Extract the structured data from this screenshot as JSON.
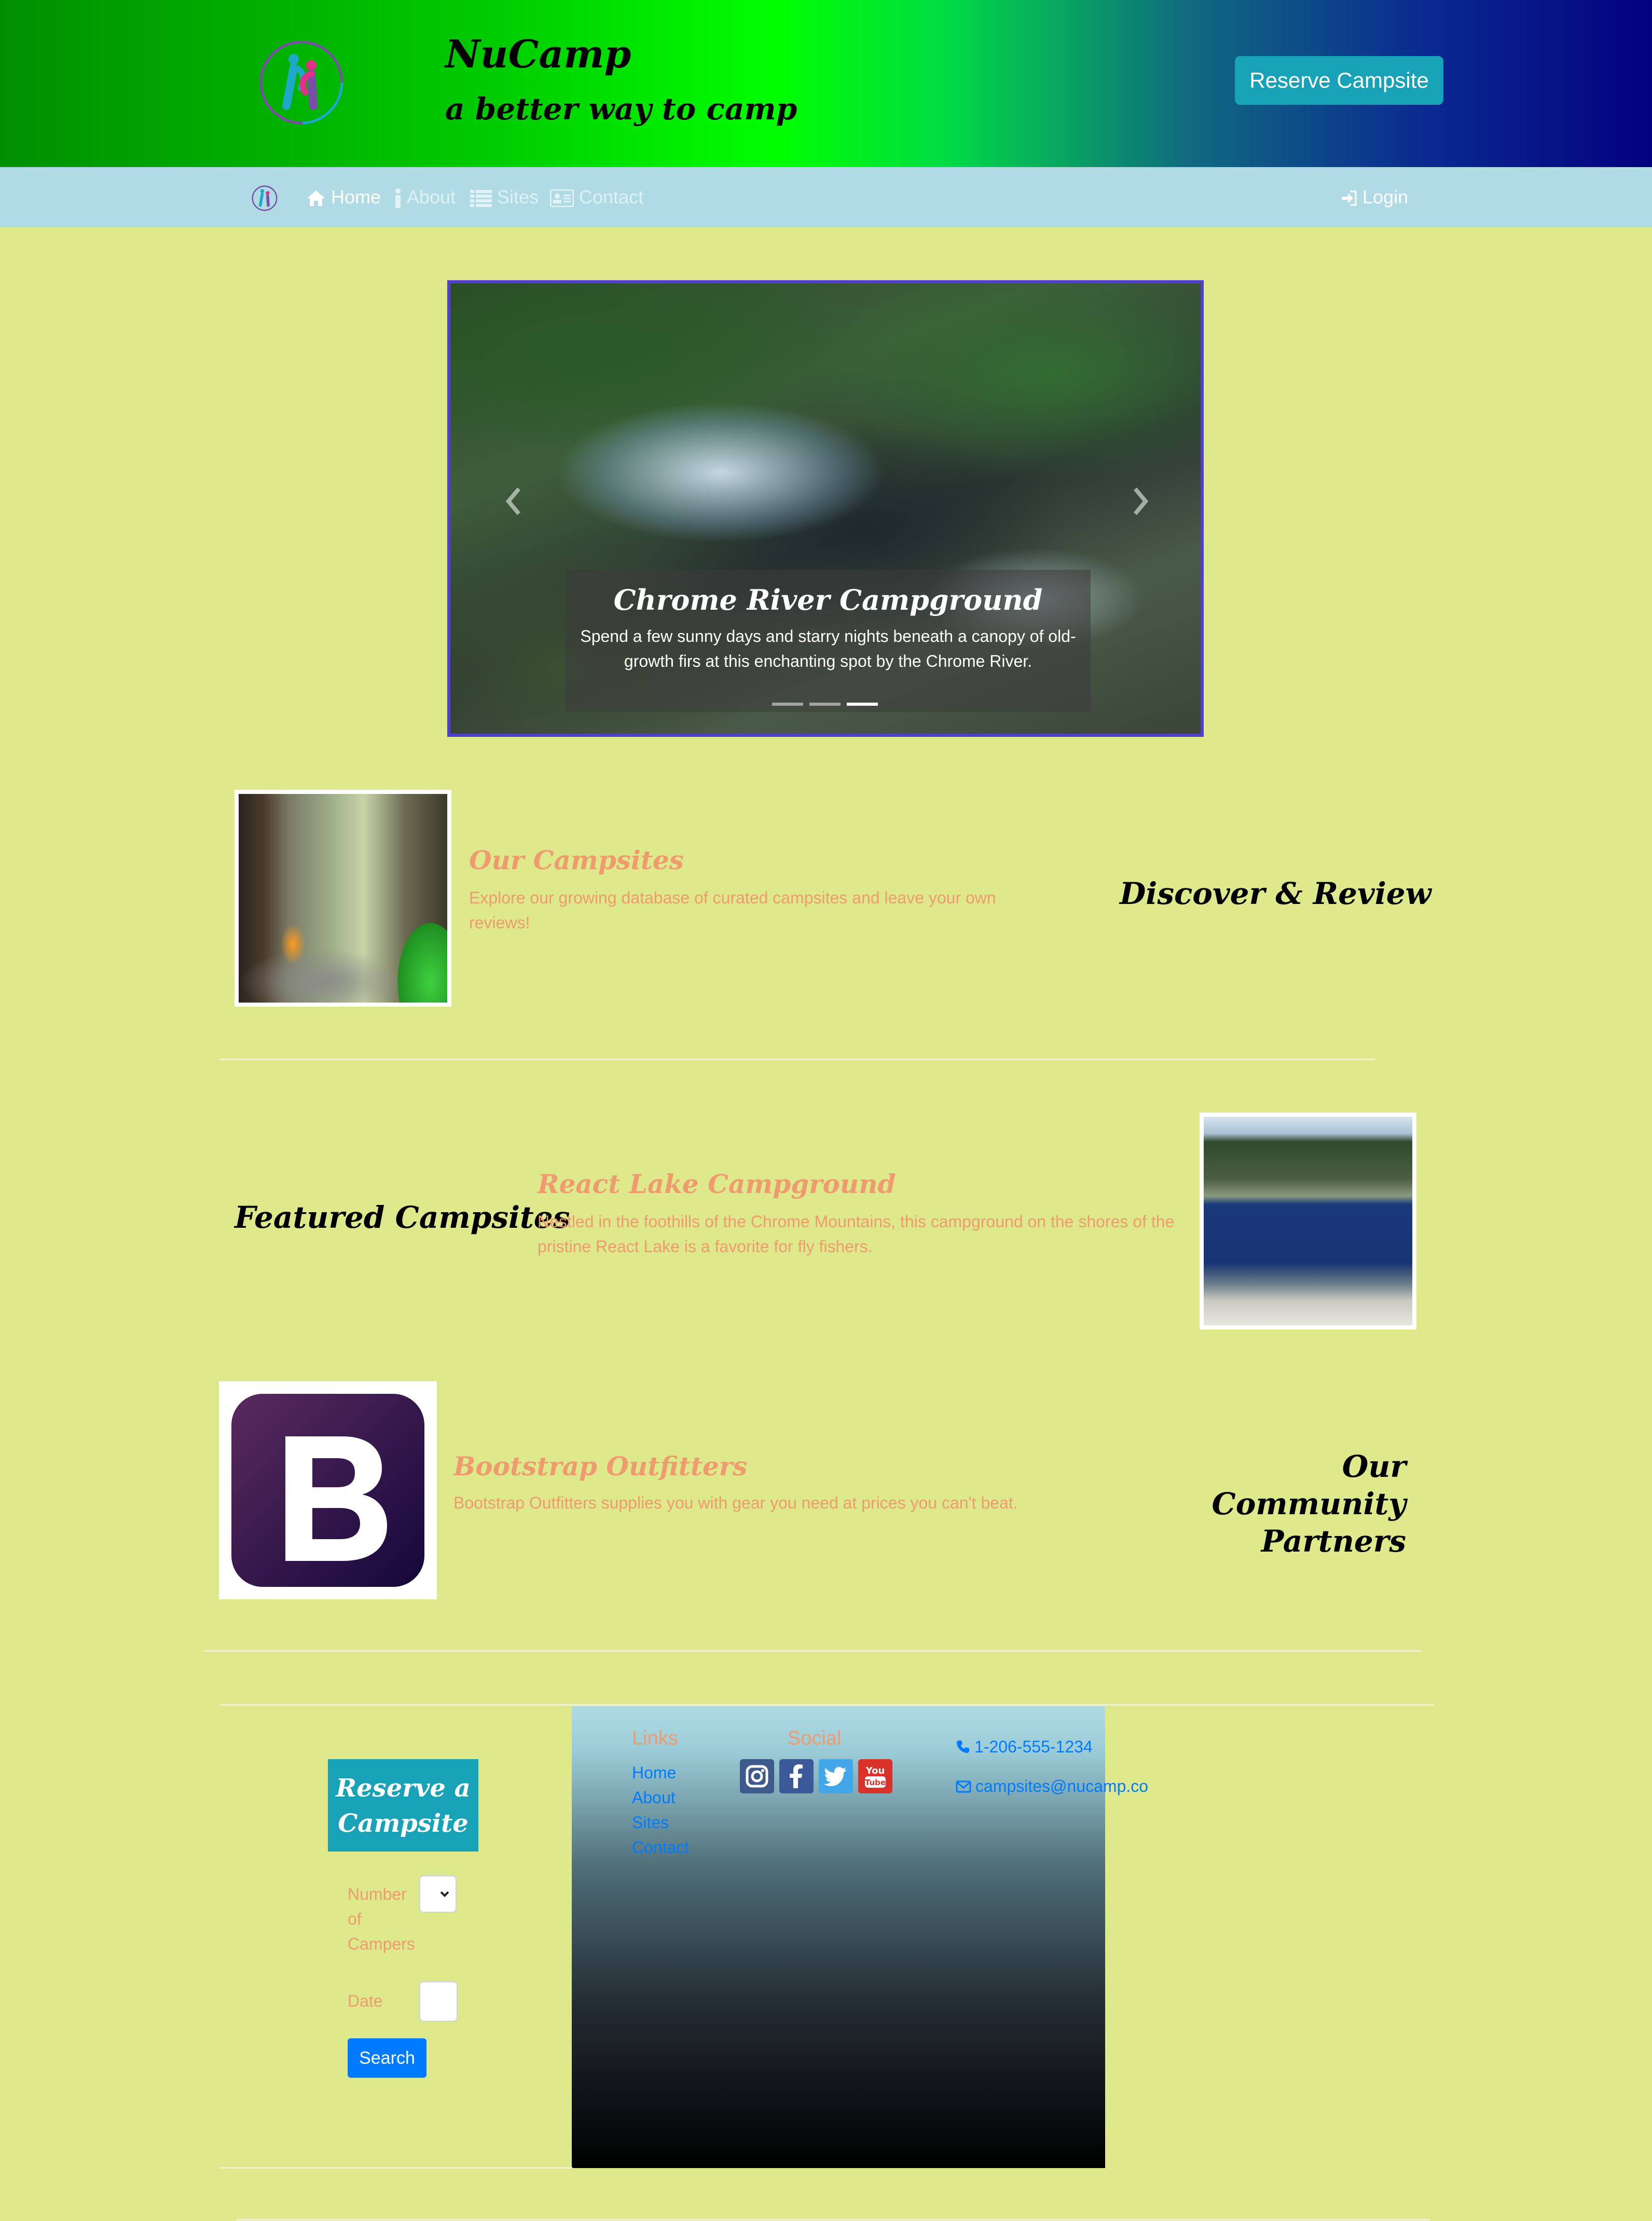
{
  "header": {
    "title": "NuCamp",
    "subtitle": "a better way to camp",
    "reserve_button": "Reserve Campsite",
    "logo_icon": "nucamp-logo-icon"
  },
  "nav": {
    "items": [
      {
        "label": "Home",
        "icon": "home-icon",
        "active": true
      },
      {
        "label": "About",
        "icon": "info-icon",
        "active": false
      },
      {
        "label": "Sites",
        "icon": "list-icon",
        "active": false
      },
      {
        "label": "Contact",
        "icon": "address-card-icon",
        "active": false
      }
    ],
    "login": "Login"
  },
  "carousel": {
    "title": "Chrome River Campground",
    "text": "Spend a few sunny days and starry nights beneath a canopy of old-growth firs at this enchanting spot by the Chrome River.",
    "indicator_count": 3,
    "active_indicator": 3
  },
  "sections": {
    "campsites": {
      "heading": "Our Campsites",
      "text": "Explore our growing database of curated campsites and leave your own reviews!",
      "side_heading": "Discover & Review"
    },
    "featured": {
      "side_heading": "Featured Campsites",
      "heading": "React Lake Campground",
      "text": "Nestled in the foothills of the Chrome Mountains, this campground on the shores of the pristine React Lake is a favorite for fly fishers."
    },
    "partners": {
      "heading": "Bootstrap Outfitters",
      "text": "Bootstrap Outfitters supplies you with gear you need at prices you can't beat.",
      "side_heading_line1": "Our Community",
      "side_heading_line2": "Partners"
    }
  },
  "reserve_form": {
    "title_line1": "Reserve a",
    "title_line2": "Campsite",
    "campers_label_1": "Number",
    "campers_label_2": "of",
    "campers_label_3": "Campers",
    "date_label": "Date",
    "search_button": "Search"
  },
  "footer": {
    "links_heading": "Links",
    "links": [
      "Home",
      "About",
      "Sites",
      "Contact"
    ],
    "social_heading": "Social",
    "social_icons": [
      "instagram-icon",
      "facebook-icon",
      "twitter-icon",
      "youtube-icon"
    ],
    "phone": "1-206-555-1234",
    "email": "campsites@nucamp.co"
  },
  "colors": {
    "page_bg": "#dde98a",
    "accent": "#17a2b8",
    "link": "#007bff",
    "section_text": "#f09a70",
    "navbar_bg": "#b0dbe5"
  }
}
